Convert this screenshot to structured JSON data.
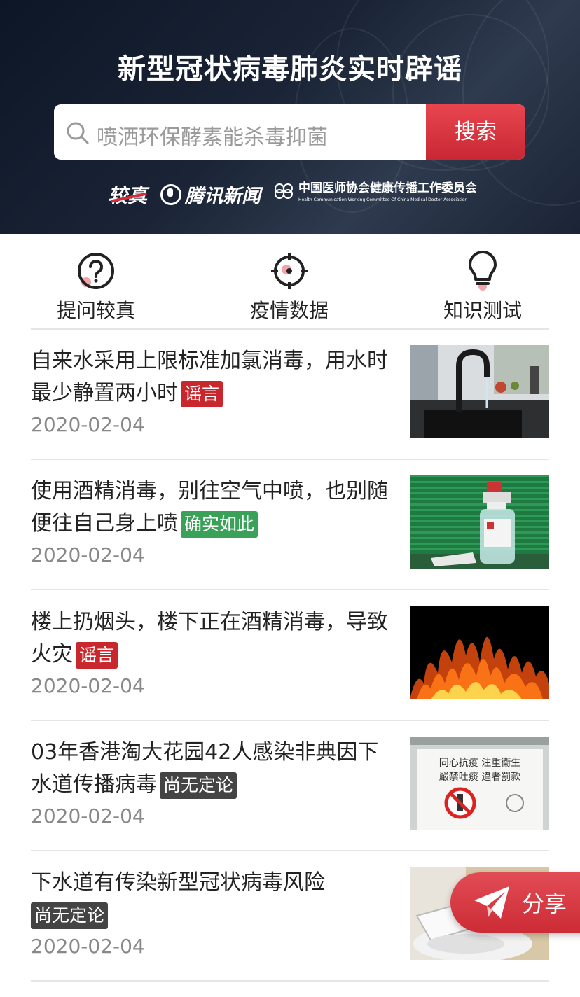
{
  "header": {
    "title": "新型冠状病毒肺炎实时辟谣",
    "search_placeholder": "喷洒环保酵素能杀毒抑菌",
    "search_button": "搜索",
    "logos": {
      "jiaozhen": "较真",
      "tencent": "腾讯新闻",
      "cmda_cn": "中国医师协会健康传播工作委员会",
      "cmda_en": "Health Communication Working Committee Of China Medical Doctor Association"
    }
  },
  "nav": [
    {
      "label": "提问较真",
      "icon": "question-icon"
    },
    {
      "label": "疫情数据",
      "icon": "target-icon"
    },
    {
      "label": "知识测试",
      "icon": "lightbulb-icon"
    }
  ],
  "articles": [
    {
      "title": "自来水采用上限标准加氯消毒，用水时最少静置两小时",
      "tag": "谣言",
      "tag_color": "#c8272e",
      "date": "2020-02-04",
      "thumb": "faucet-sink-photo"
    },
    {
      "title": "使用酒精消毒，别往空气中喷，也别随便往自己身上喷",
      "tag": "确实如此",
      "tag_color": "#3aa158",
      "date": "2020-02-04",
      "thumb": "alcohol-spray-bottle-photo"
    },
    {
      "title": "楼上扔烟头，楼下正在酒精消毒，导致火灾",
      "tag": "谣言",
      "tag_color": "#c8272e",
      "date": "2020-02-04",
      "thumb": "fire-photo"
    },
    {
      "title": "03年香港淘大花园42人感染非典因下水道传播病毒",
      "tag": "尚无定论",
      "tag_color": "#444444",
      "date": "2020-02-04",
      "thumb": "no-spitting-sign-photo"
    },
    {
      "title": "下水道有传染新型冠状病毒风险",
      "tag": "尚无定论",
      "tag_color": "#444444",
      "date": "2020-02-04",
      "thumb": "toilet-photo"
    }
  ],
  "sign_text": {
    "line1": "同心抗疫 注重衞生",
    "line2": "嚴禁吐痰 違者罰款"
  },
  "share_label": "分享"
}
